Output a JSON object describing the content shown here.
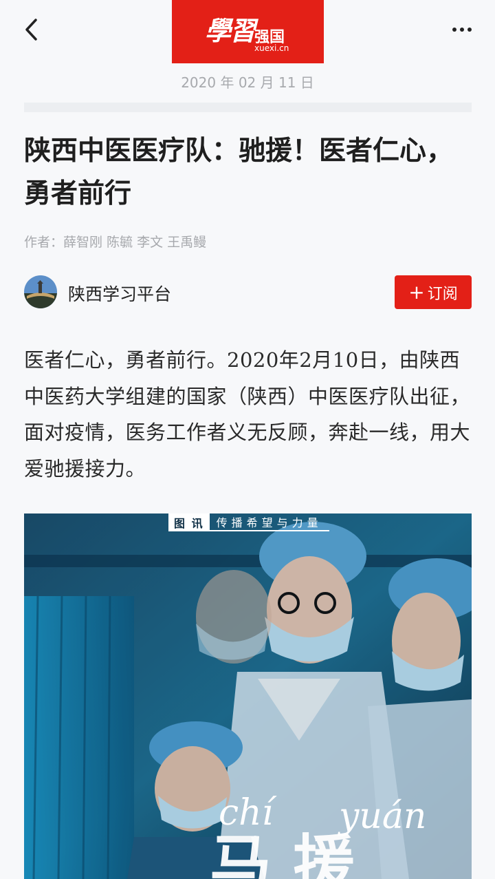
{
  "header": {
    "back_icon": "chevron-left-icon",
    "logo_script": "學習",
    "logo_text": "强国",
    "logo_domain": "xuexi.cn",
    "more_icon": "more-dots-icon"
  },
  "article": {
    "date": "2020 年 02 月 11 日",
    "title": "陕西中医医疗队：驰援！医者仁心，勇者前行",
    "author": "作者：薛智刚 陈毓 李文 王禹鳗",
    "channel_name": "陕西学习平台",
    "subscribe_label": "订阅",
    "body": "医者仁心，勇者前行。2020年2月10日，由陕西中医药大学组建的国家（陕西）中医医疗队出征，面对疫情，医务工作者义无反顾，奔赴一线，用大爱驰援接力。"
  },
  "image": {
    "tag_label": "图 讯",
    "tag_sub": "传播希望与力量",
    "pinyin_1": "chí",
    "pinyin_2": "yuán"
  },
  "colors": {
    "brand_red": "#e32017",
    "muted": "#a7a9ad",
    "background": "#f7f8fa"
  }
}
